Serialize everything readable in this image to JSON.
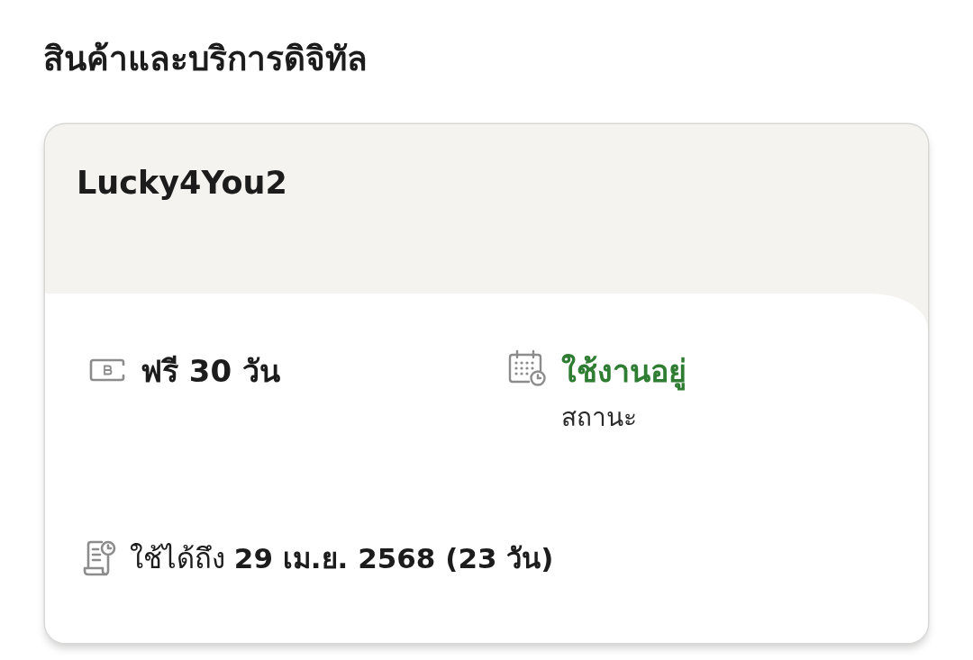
{
  "page": {
    "title": "สินค้าและบริการดิจิทัล"
  },
  "card": {
    "name": "Lucky4You2",
    "details": [
      {
        "kind": "price",
        "value": "ฟรี 30 วัน"
      },
      {
        "kind": "status",
        "value": "ใช้งานอยู่",
        "label": "สถานะ",
        "active": true
      }
    ],
    "validity": "ใช้ได้ถึง **29 เม.ย. 2568 (23 วัน)**"
  }
}
